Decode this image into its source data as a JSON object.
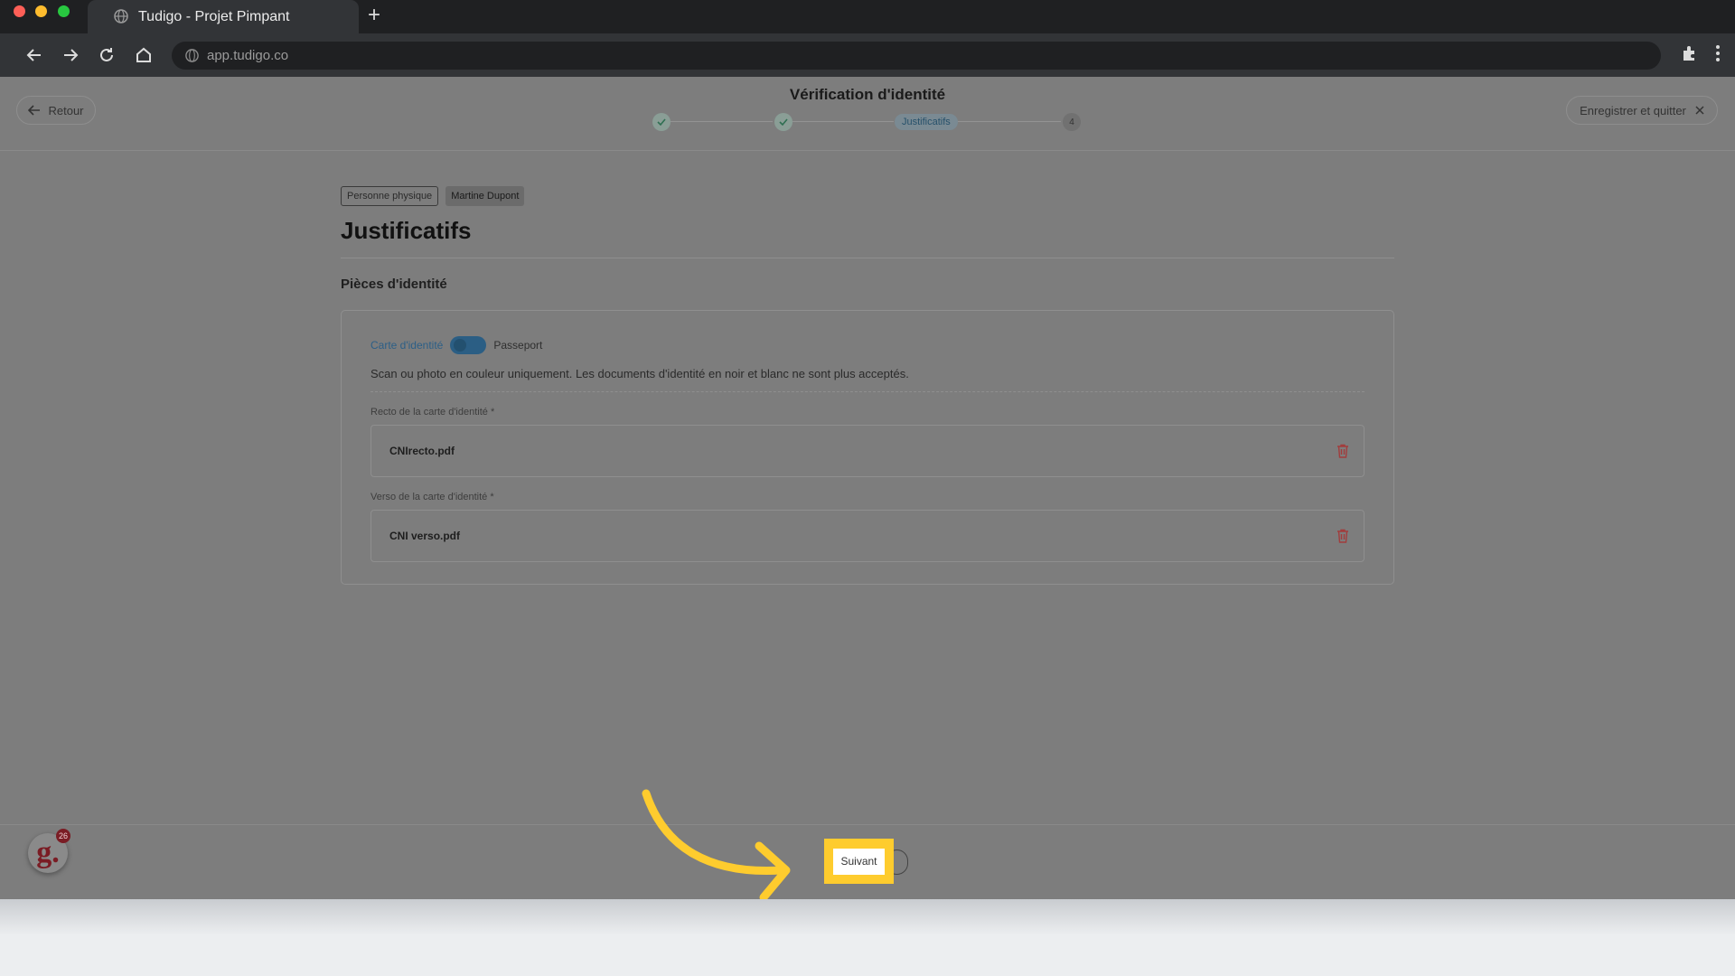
{
  "browser": {
    "tab_title": "Tudigo - Projet Pimpant",
    "url": "app.tudigo.co"
  },
  "header": {
    "back_label": "Retour",
    "title": "Vérification d'identité",
    "steps": {
      "current_label": "Justificatifs",
      "last_number": "4"
    },
    "save_quit_label": "Enregistrer et quitter"
  },
  "content": {
    "badges": [
      "Personne physique",
      "Martine Dupont"
    ],
    "title": "Justificatifs",
    "subtitle": "Pièces d'identité",
    "toggle": {
      "left_label": "Carte d'identité",
      "right_label": "Passeport"
    },
    "note": "Scan ou photo en couleur uniquement. Les documents d'identité en noir et blanc ne sont plus acceptés.",
    "fields": [
      {
        "label": "Recto de la carte d'identité *",
        "file": "CNIrecto.pdf"
      },
      {
        "label": "Verso de la carte d'identité *",
        "file": "CNI verso.pdf"
      }
    ]
  },
  "footer": {
    "next_label": "Suivant",
    "avatar_letter": "g.",
    "avatar_badge": "26"
  },
  "colors": {
    "highlight": "#fecc2e",
    "overlay": "#7d7d7d",
    "delete": "#a23c3c"
  }
}
